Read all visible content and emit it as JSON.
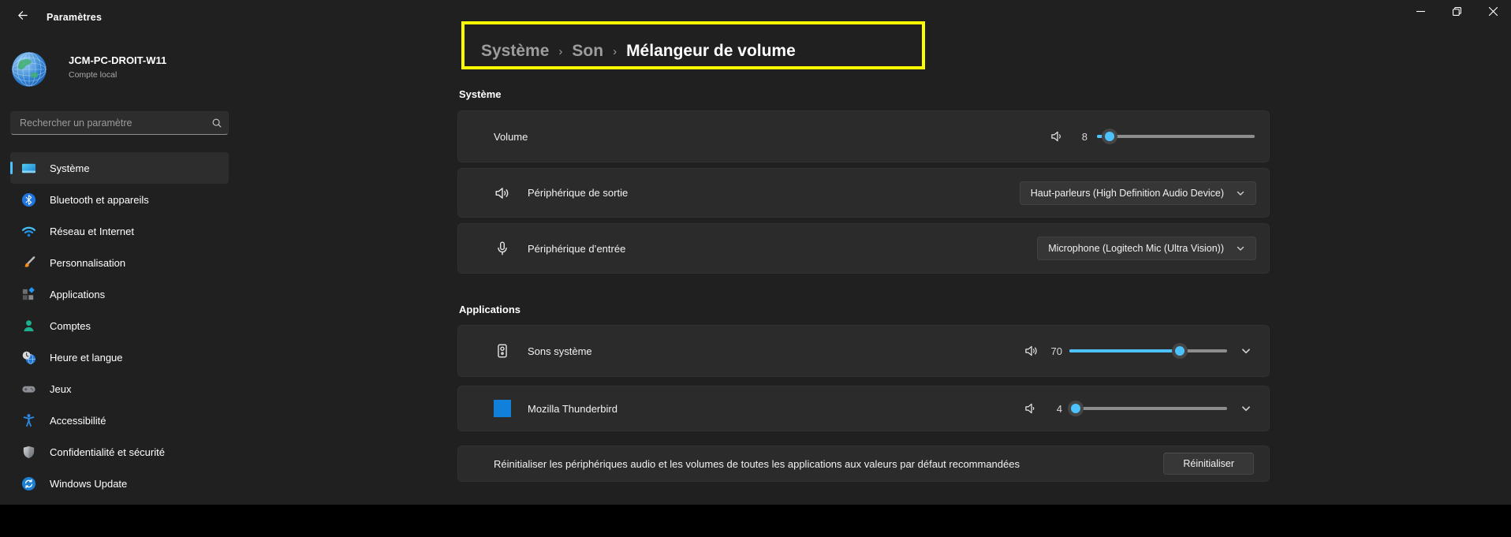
{
  "window": {
    "title": "Paramètres"
  },
  "profile": {
    "name": "JCM-PC-DROIT-W11",
    "account_type": "Compte local"
  },
  "search": {
    "placeholder": "Rechercher un paramètre"
  },
  "sidebar": {
    "items": [
      {
        "label": "Système",
        "icon": "system-icon",
        "selected": true
      },
      {
        "label": "Bluetooth et appareils",
        "icon": "bluetooth-icon",
        "selected": false
      },
      {
        "label": "Réseau et Internet",
        "icon": "network-icon",
        "selected": false
      },
      {
        "label": "Personnalisation",
        "icon": "personalization-icon",
        "selected": false
      },
      {
        "label": "Applications",
        "icon": "apps-icon",
        "selected": false
      },
      {
        "label": "Comptes",
        "icon": "accounts-icon",
        "selected": false
      },
      {
        "label": "Heure et langue",
        "icon": "time-language-icon",
        "selected": false
      },
      {
        "label": "Jeux",
        "icon": "gaming-icon",
        "selected": false
      },
      {
        "label": "Accessibilité",
        "icon": "accessibility-icon",
        "selected": false
      },
      {
        "label": "Confidentialité et sécurité",
        "icon": "privacy-icon",
        "selected": false
      },
      {
        "label": "Windows Update",
        "icon": "windows-update-icon",
        "selected": false
      }
    ]
  },
  "breadcrumb": {
    "separator": "›",
    "items": [
      "Système",
      "Son",
      "Mélangeur de volume"
    ],
    "highlight_color": "#ffff00"
  },
  "system_section": {
    "title": "Système",
    "volume": {
      "label": "Volume",
      "value": 8,
      "max": 100
    },
    "output": {
      "label": "Périphérique de sortie",
      "selected": "Haut-parleurs (High Definition Audio Device)"
    },
    "input": {
      "label": "Périphérique d’entrée",
      "selected": "Microphone (Logitech Mic (Ultra Vision))"
    }
  },
  "apps_section": {
    "title": "Applications",
    "system_sounds": {
      "label": "Sons système",
      "value": 70,
      "max": 100
    },
    "thunderbird": {
      "label": "Mozilla Thunderbird",
      "value": 4,
      "max": 100
    },
    "reset": {
      "description": "Réinitialiser les périphériques audio et les volumes de toutes les applications aux valeurs par défaut recommandées",
      "button_label": "Réinitialiser"
    }
  },
  "colors": {
    "accent": "#4cc2ff",
    "annotation_highlight": "#ffff00",
    "thunderbird_icon_blue": "#1180da",
    "page_background": "#202020",
    "card_background": "#2b2b2b"
  }
}
